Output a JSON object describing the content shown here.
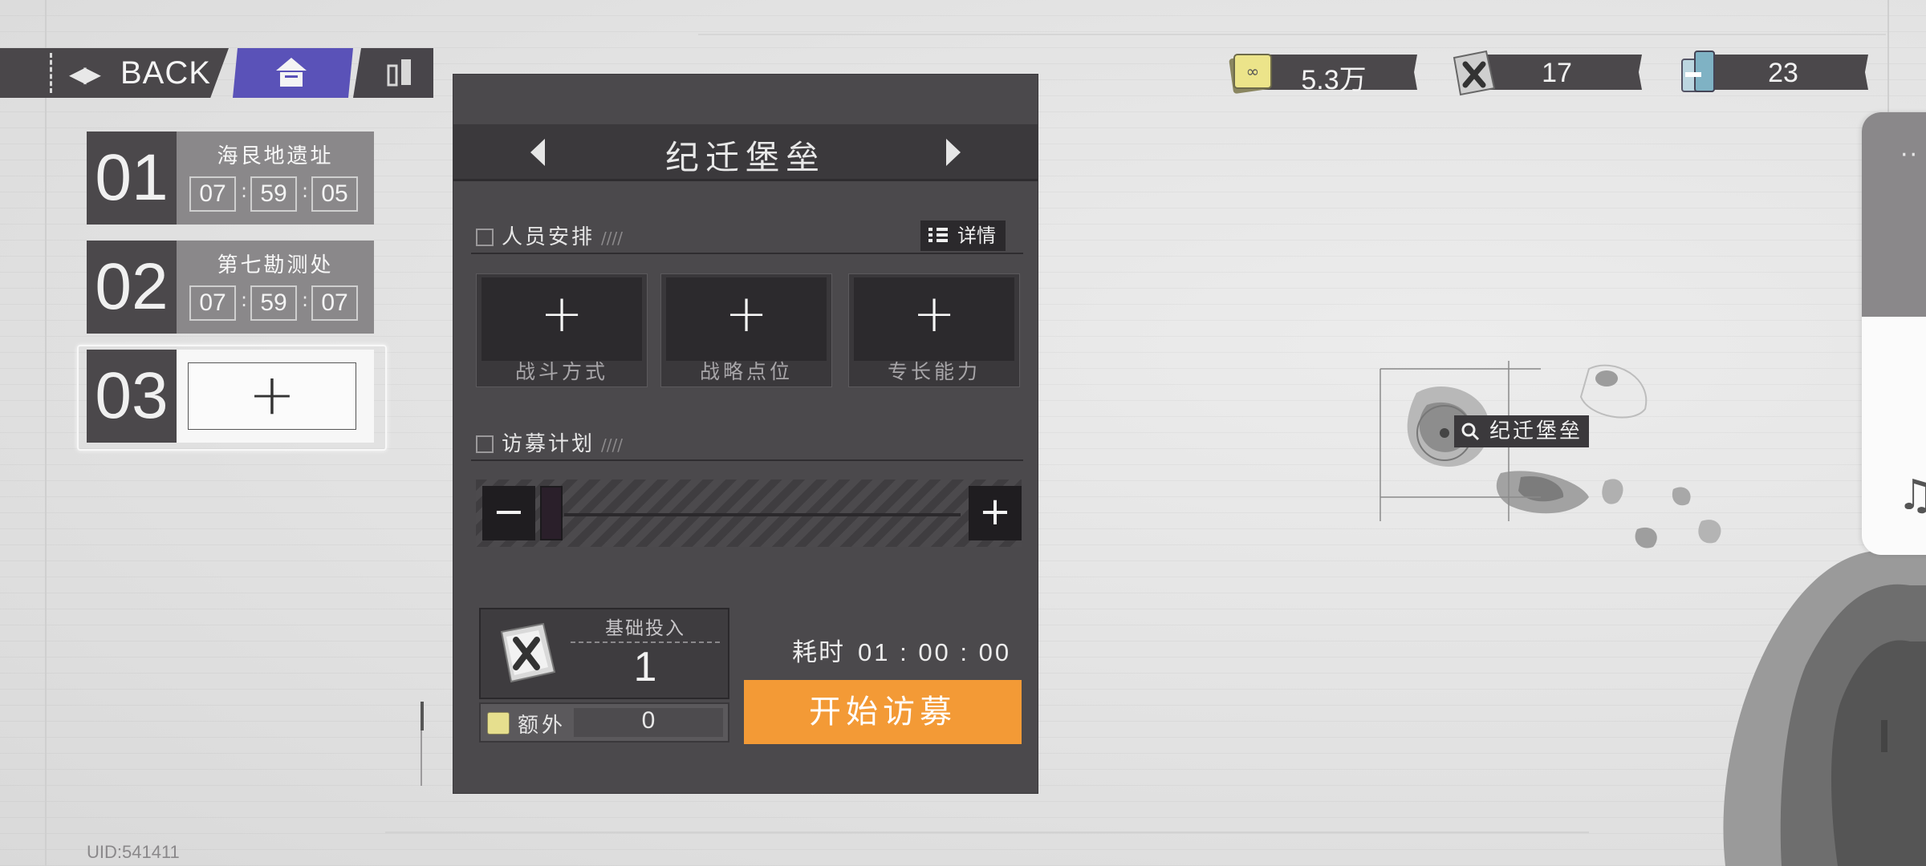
{
  "nav": {
    "back_label": "BACK"
  },
  "slots": [
    {
      "num": "01",
      "name": "海艮地遗址",
      "time": [
        "07",
        "59",
        "05"
      ]
    },
    {
      "num": "02",
      "name": "第七勘测处",
      "time": [
        "07",
        "59",
        "07"
      ]
    },
    {
      "num": "03",
      "add": "+"
    }
  ],
  "panel": {
    "title": "纪迁堡垒",
    "section1": {
      "title": "人员安排",
      "slash": "////",
      "detail_label": "详情"
    },
    "cards": [
      {
        "plus": "+",
        "label": "战斗方式"
      },
      {
        "plus": "+",
        "label": "战略点位"
      },
      {
        "plus": "+",
        "label": "专长能力"
      }
    ],
    "section2": {
      "title": "访募计划",
      "slash": "////"
    },
    "slider": {
      "minus": "−",
      "plus": "+",
      "value_fraction": 0.0
    },
    "cost": {
      "label": "基础投入",
      "value": "1"
    },
    "extra": {
      "label": "额外",
      "value": "0"
    },
    "duration": {
      "label": "耗时",
      "value": "01 : 00 : 00"
    },
    "start_label": "开始访募"
  },
  "currencies": [
    {
      "icon": "gold-card-icon",
      "value": "5.3万"
    },
    {
      "icon": "x-tag-icon",
      "value": "17"
    },
    {
      "icon": "supply-pack-icon",
      "value": "23"
    }
  ],
  "map": {
    "marker_label": "纪迁堡垒"
  },
  "side": {
    "dots": "··",
    "note": "♫"
  },
  "footer": {
    "uid": "UID:541411"
  },
  "colors": {
    "accent": "#f39a36",
    "home": "#5a52b8",
    "panel": "#4b494c"
  }
}
